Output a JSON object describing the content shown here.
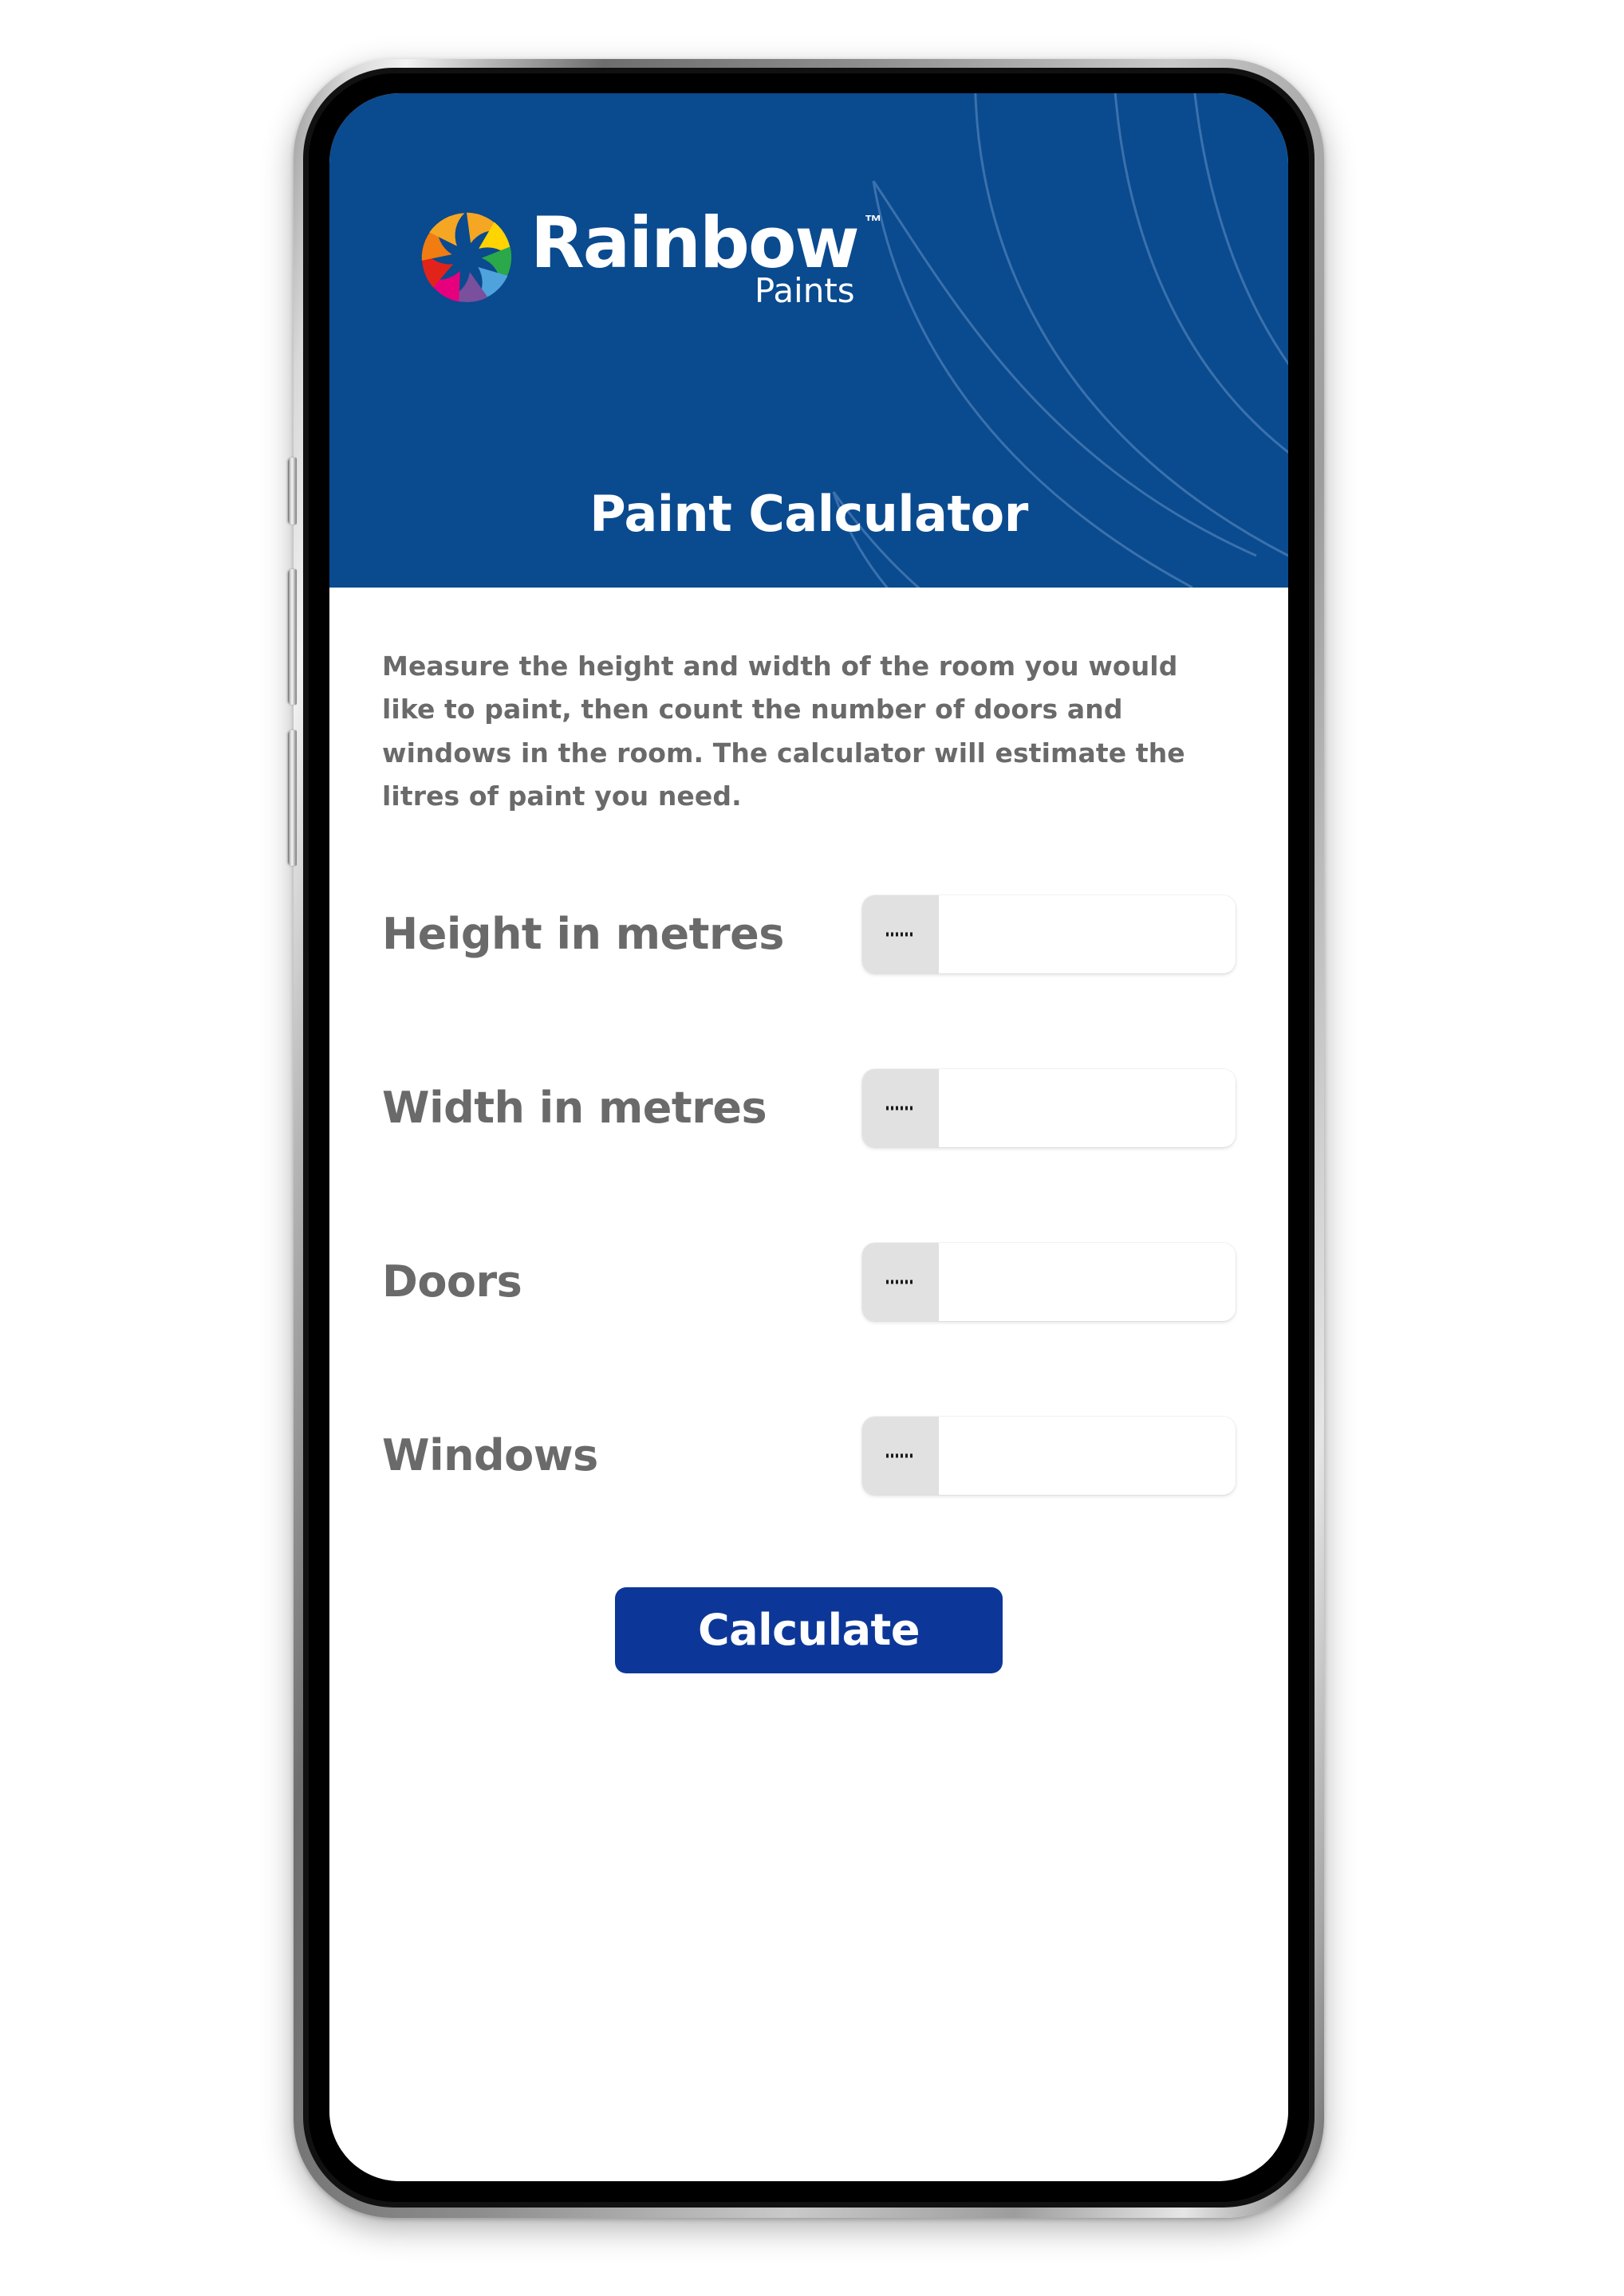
{
  "brand": {
    "logo_icon": "rainbow-swirl-icon",
    "name": "Rainbow",
    "trademark": "™",
    "tagline": "Paints",
    "header_bg": "#0a4a8f",
    "accent": "#0c3799",
    "label_color": "#6a6a6a"
  },
  "header": {
    "title": "Paint Calculator"
  },
  "main": {
    "intro": "Measure the height and width of the room you would like to paint, then count the number of doors and windows in the room. The calculator will estimate the litres of paint you need.",
    "fields": [
      {
        "label": "Height in metres",
        "value": "",
        "placeholder": "",
        "decrement_icon": "minus-icon",
        "increment_icon": "plus-icon"
      },
      {
        "label": "Width in metres",
        "value": "",
        "placeholder": "",
        "decrement_icon": "minus-icon",
        "increment_icon": "plus-icon"
      },
      {
        "label": "Doors",
        "value": "",
        "placeholder": "",
        "decrement_icon": "minus-icon",
        "increment_icon": "plus-icon"
      },
      {
        "label": "Windows",
        "value": "",
        "placeholder": "",
        "decrement_icon": "minus-icon",
        "increment_icon": "plus-icon"
      }
    ],
    "submit_label": "Calculate"
  },
  "device": {
    "type": "smartphone-mockup",
    "buttons": [
      "mute-switch",
      "volume-up-button",
      "volume-down-button"
    ]
  }
}
